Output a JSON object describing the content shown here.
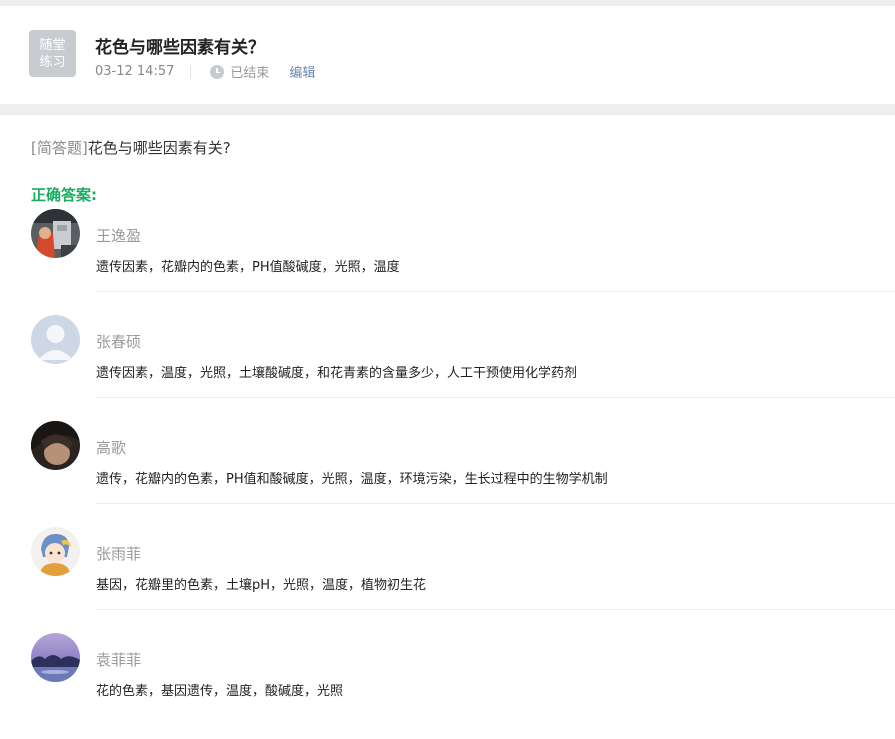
{
  "header": {
    "badge_line1": "随堂",
    "badge_line2": "练习",
    "title": "花色与哪些因素有关？",
    "datetime": "03-12 14:57",
    "status": "已结束",
    "edit_label": "编辑"
  },
  "question": {
    "type_tag": "[简答题]",
    "text": "花色与哪些因素有关?"
  },
  "answer_label": "正确答案:",
  "answers": [
    {
      "name": "王逸盈",
      "text": "遗传因素，花瓣内的色素，PH值酸碱度，光照，温度",
      "avatar": "photo-avatar"
    },
    {
      "name": "张春硕",
      "text": "遗传因素，温度，光照，土壤酸碱度，和花青素的含量多少，人工干预使用化学药剂",
      "avatar": "default-avatar"
    },
    {
      "name": "高歌",
      "text": "遗传，花瓣内的色素，PH值和酸碱度，光照，温度，环境污染，生长过程中的生物学机制",
      "avatar": "photo-avatar"
    },
    {
      "name": "张雨菲",
      "text": "基因，花瓣里的色素，土壤pH，光照，温度，植物初生花",
      "avatar": "cartoon-avatar"
    },
    {
      "name": "袁菲菲",
      "text": "花的色素，基因遗传，温度，酸碱度，光照",
      "avatar": "landscape-avatar"
    }
  ],
  "colors": {
    "accent_green": "#1aad61",
    "link_blue": "#6a88b0",
    "badge_gray": "#c8ccd1"
  }
}
